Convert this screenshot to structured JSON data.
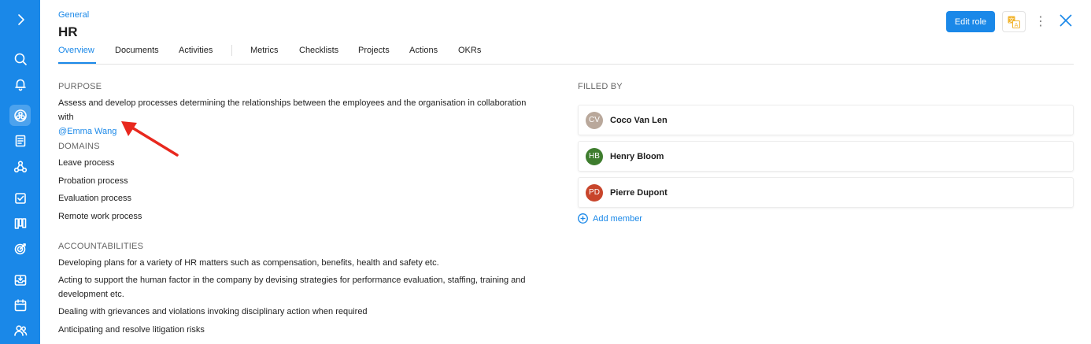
{
  "header": {
    "breadcrumb": "General",
    "title": "HR",
    "edit_button": "Edit role",
    "more_button": "⋮"
  },
  "tabs": [
    {
      "label": "Overview",
      "active": true
    },
    {
      "label": "Documents"
    },
    {
      "label": "Activities"
    },
    {
      "label": "Metrics"
    },
    {
      "label": "Checklists"
    },
    {
      "label": "Projects"
    },
    {
      "label": "Actions"
    },
    {
      "label": "OKRs"
    }
  ],
  "purpose": {
    "label": "PURPOSE",
    "text": "Assess and develop processes determining the relationships between the employees and the organisation in collaboration with",
    "mention": "@Emma Wang"
  },
  "domains": {
    "label": "DOMAINS",
    "items": [
      "Leave process",
      "Probation process",
      "Evaluation process",
      "Remote work process"
    ]
  },
  "accountabilities": {
    "label": "ACCOUNTABILITIES",
    "items": [
      "Developing plans for a variety of HR matters such as compensation, benefits, health and safety etc.",
      "Acting to support the human factor in the company by devising strategies for performance evaluation, staffing, training and development etc.",
      "Dealing with grievances and violations invoking disciplinary action when required",
      "Anticipating and resolve litigation risks"
    ]
  },
  "filled_by": {
    "label": "FILLED BY",
    "members": [
      {
        "initials": "CV",
        "name": "Coco Van Len",
        "color": "#b9a89b"
      },
      {
        "initials": "HB",
        "name": "Henry Bloom",
        "color": "#3e7d2e"
      },
      {
        "initials": "PD",
        "name": "Pierre Dupont",
        "color": "#c8452b"
      }
    ],
    "add_label": "Add member"
  },
  "colors": {
    "accent": "#1a88e8",
    "annotation_arrow": "#e8281e"
  },
  "sidebar_icons": [
    "chevron-right-icon",
    "search-icon",
    "bell-icon",
    "roles-icon",
    "document-icon",
    "network-icon",
    "checklist-icon",
    "kanban-icon",
    "target-icon",
    "inbox-icon",
    "calendar-icon",
    "users-icon"
  ]
}
